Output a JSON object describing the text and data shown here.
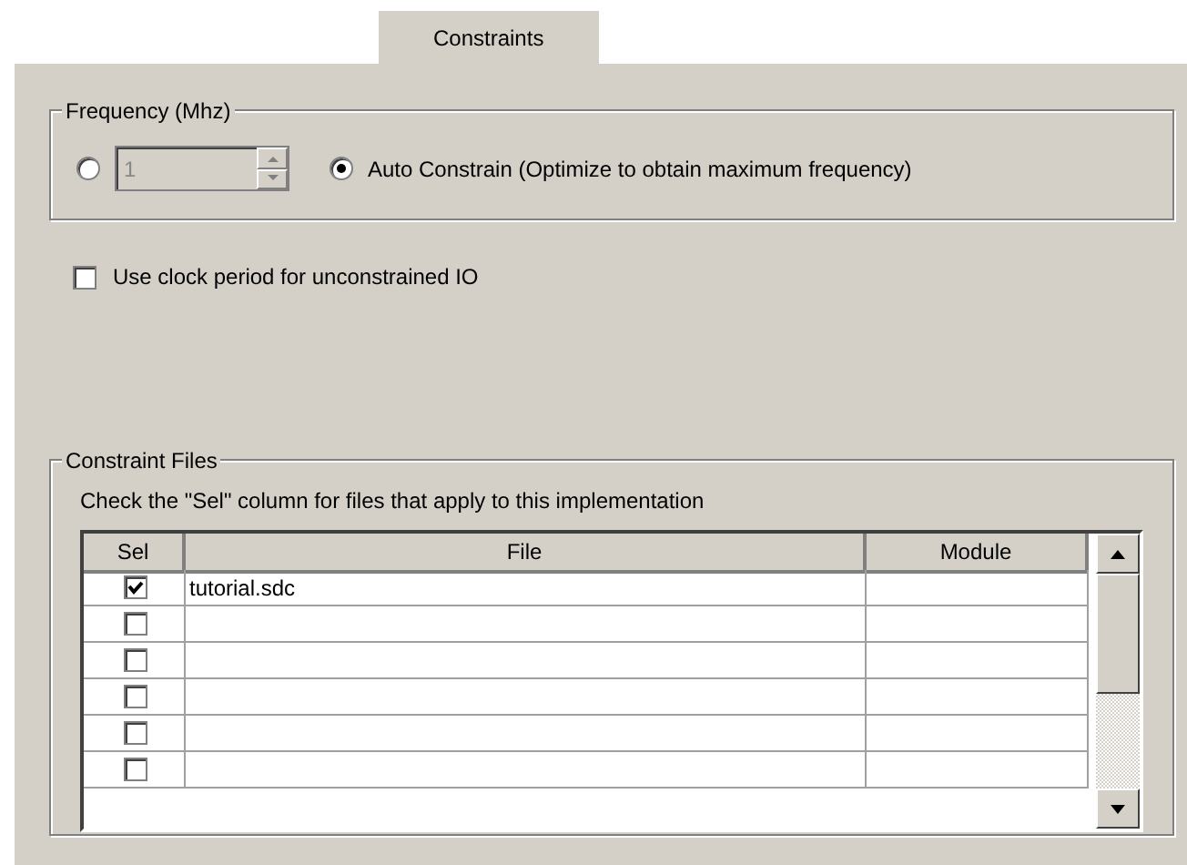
{
  "tabs": [
    {
      "label": "Constraints",
      "selected": true
    }
  ],
  "frequency": {
    "title": "Frequency (Mhz)",
    "options": [
      {
        "kind": "spin",
        "selected": false,
        "value": "1",
        "disabled": true
      },
      {
        "kind": "label",
        "selected": true,
        "label": "Auto Constrain (Optimize to obtain maximum frequency)"
      }
    ]
  },
  "clock_option": {
    "label": "Use clock period for unconstrained IO",
    "checked": false
  },
  "constraint_files": {
    "title": "Constraint Files",
    "hint": "Check the \"Sel\" column for files that apply to this implementation",
    "columns": [
      "Sel",
      "File",
      "Module"
    ],
    "rows": [
      {
        "checked": true,
        "file": "tutorial.sdc"
      },
      {
        "checked": false
      },
      {
        "checked": false
      },
      {
        "checked": false
      },
      {
        "checked": false
      },
      {
        "checked": false
      }
    ]
  }
}
